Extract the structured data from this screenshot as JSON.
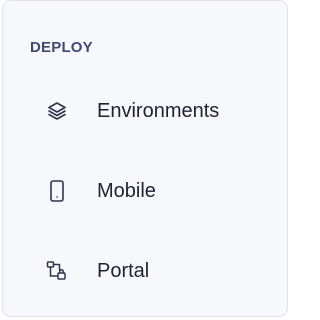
{
  "sidebar": {
    "section_title": "DEPLOY",
    "items": [
      {
        "label": "Environments",
        "icon": "layers-icon"
      },
      {
        "label": "Mobile",
        "icon": "mobile-device-icon"
      },
      {
        "label": "Portal",
        "icon": "portal-icon"
      }
    ]
  },
  "colors": {
    "panel_background": "#f7f8fc",
    "panel_border": "#dfe2ec",
    "section_title": "#3f4a6f",
    "item_text": "#1e2330",
    "icon": "#30364a"
  }
}
